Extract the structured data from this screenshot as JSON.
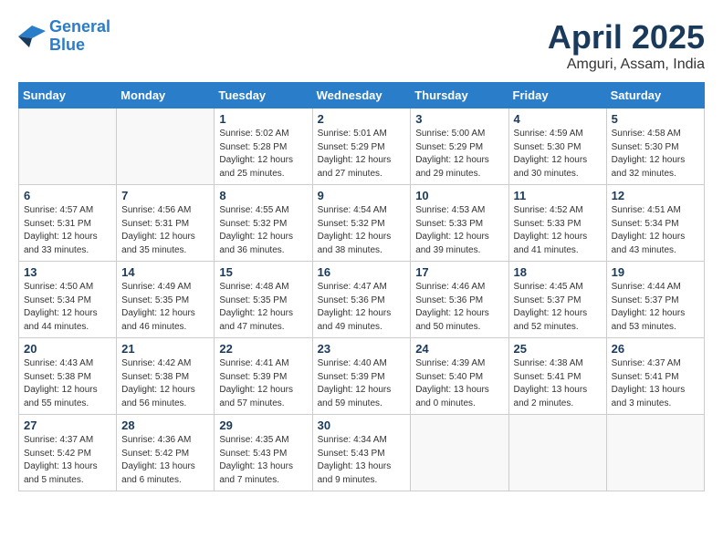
{
  "logo": {
    "line1": "General",
    "line2": "Blue"
  },
  "title": "April 2025",
  "location": "Amguri, Assam, India",
  "headers": [
    "Sunday",
    "Monday",
    "Tuesday",
    "Wednesday",
    "Thursday",
    "Friday",
    "Saturday"
  ],
  "weeks": [
    [
      {
        "day": "",
        "info": ""
      },
      {
        "day": "",
        "info": ""
      },
      {
        "day": "1",
        "info": "Sunrise: 5:02 AM\nSunset: 5:28 PM\nDaylight: 12 hours\nand 25 minutes."
      },
      {
        "day": "2",
        "info": "Sunrise: 5:01 AM\nSunset: 5:29 PM\nDaylight: 12 hours\nand 27 minutes."
      },
      {
        "day": "3",
        "info": "Sunrise: 5:00 AM\nSunset: 5:29 PM\nDaylight: 12 hours\nand 29 minutes."
      },
      {
        "day": "4",
        "info": "Sunrise: 4:59 AM\nSunset: 5:30 PM\nDaylight: 12 hours\nand 30 minutes."
      },
      {
        "day": "5",
        "info": "Sunrise: 4:58 AM\nSunset: 5:30 PM\nDaylight: 12 hours\nand 32 minutes."
      }
    ],
    [
      {
        "day": "6",
        "info": "Sunrise: 4:57 AM\nSunset: 5:31 PM\nDaylight: 12 hours\nand 33 minutes."
      },
      {
        "day": "7",
        "info": "Sunrise: 4:56 AM\nSunset: 5:31 PM\nDaylight: 12 hours\nand 35 minutes."
      },
      {
        "day": "8",
        "info": "Sunrise: 4:55 AM\nSunset: 5:32 PM\nDaylight: 12 hours\nand 36 minutes."
      },
      {
        "day": "9",
        "info": "Sunrise: 4:54 AM\nSunset: 5:32 PM\nDaylight: 12 hours\nand 38 minutes."
      },
      {
        "day": "10",
        "info": "Sunrise: 4:53 AM\nSunset: 5:33 PM\nDaylight: 12 hours\nand 39 minutes."
      },
      {
        "day": "11",
        "info": "Sunrise: 4:52 AM\nSunset: 5:33 PM\nDaylight: 12 hours\nand 41 minutes."
      },
      {
        "day": "12",
        "info": "Sunrise: 4:51 AM\nSunset: 5:34 PM\nDaylight: 12 hours\nand 43 minutes."
      }
    ],
    [
      {
        "day": "13",
        "info": "Sunrise: 4:50 AM\nSunset: 5:34 PM\nDaylight: 12 hours\nand 44 minutes."
      },
      {
        "day": "14",
        "info": "Sunrise: 4:49 AM\nSunset: 5:35 PM\nDaylight: 12 hours\nand 46 minutes."
      },
      {
        "day": "15",
        "info": "Sunrise: 4:48 AM\nSunset: 5:35 PM\nDaylight: 12 hours\nand 47 minutes."
      },
      {
        "day": "16",
        "info": "Sunrise: 4:47 AM\nSunset: 5:36 PM\nDaylight: 12 hours\nand 49 minutes."
      },
      {
        "day": "17",
        "info": "Sunrise: 4:46 AM\nSunset: 5:36 PM\nDaylight: 12 hours\nand 50 minutes."
      },
      {
        "day": "18",
        "info": "Sunrise: 4:45 AM\nSunset: 5:37 PM\nDaylight: 12 hours\nand 52 minutes."
      },
      {
        "day": "19",
        "info": "Sunrise: 4:44 AM\nSunset: 5:37 PM\nDaylight: 12 hours\nand 53 minutes."
      }
    ],
    [
      {
        "day": "20",
        "info": "Sunrise: 4:43 AM\nSunset: 5:38 PM\nDaylight: 12 hours\nand 55 minutes."
      },
      {
        "day": "21",
        "info": "Sunrise: 4:42 AM\nSunset: 5:38 PM\nDaylight: 12 hours\nand 56 minutes."
      },
      {
        "day": "22",
        "info": "Sunrise: 4:41 AM\nSunset: 5:39 PM\nDaylight: 12 hours\nand 57 minutes."
      },
      {
        "day": "23",
        "info": "Sunrise: 4:40 AM\nSunset: 5:39 PM\nDaylight: 12 hours\nand 59 minutes."
      },
      {
        "day": "24",
        "info": "Sunrise: 4:39 AM\nSunset: 5:40 PM\nDaylight: 13 hours\nand 0 minutes."
      },
      {
        "day": "25",
        "info": "Sunrise: 4:38 AM\nSunset: 5:41 PM\nDaylight: 13 hours\nand 2 minutes."
      },
      {
        "day": "26",
        "info": "Sunrise: 4:37 AM\nSunset: 5:41 PM\nDaylight: 13 hours\nand 3 minutes."
      }
    ],
    [
      {
        "day": "27",
        "info": "Sunrise: 4:37 AM\nSunset: 5:42 PM\nDaylight: 13 hours\nand 5 minutes."
      },
      {
        "day": "28",
        "info": "Sunrise: 4:36 AM\nSunset: 5:42 PM\nDaylight: 13 hours\nand 6 minutes."
      },
      {
        "day": "29",
        "info": "Sunrise: 4:35 AM\nSunset: 5:43 PM\nDaylight: 13 hours\nand 7 minutes."
      },
      {
        "day": "30",
        "info": "Sunrise: 4:34 AM\nSunset: 5:43 PM\nDaylight: 13 hours\nand 9 minutes."
      },
      {
        "day": "",
        "info": ""
      },
      {
        "day": "",
        "info": ""
      },
      {
        "day": "",
        "info": ""
      }
    ]
  ]
}
